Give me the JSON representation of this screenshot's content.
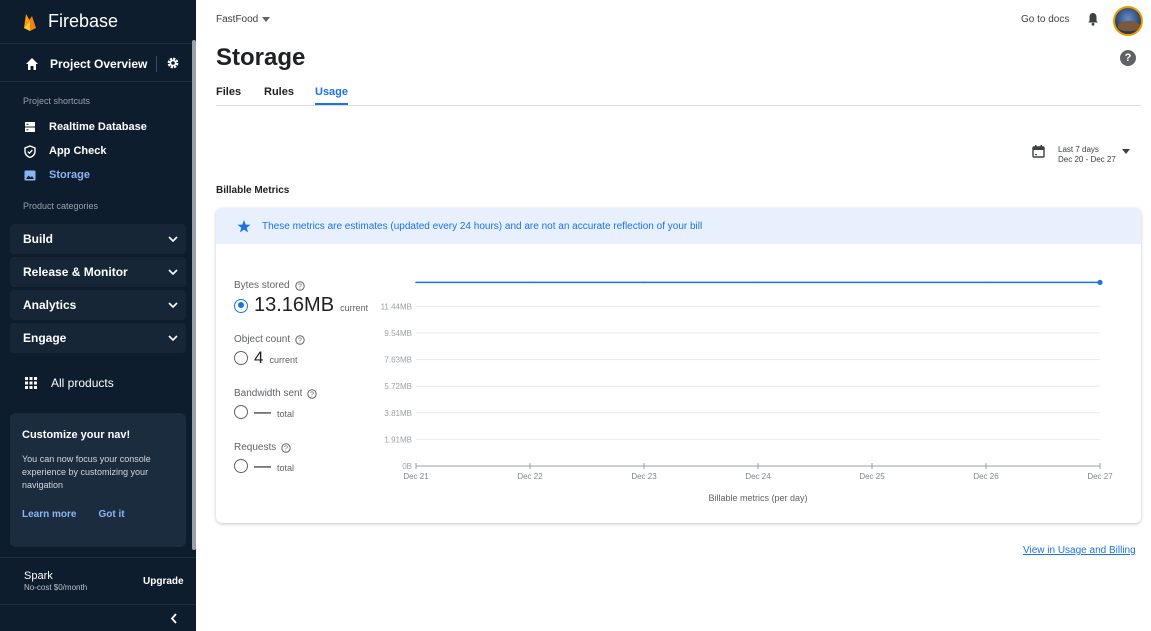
{
  "sidebar": {
    "brand": "Firebase",
    "project_overview": "Project Overview",
    "shortcuts_label": "Project shortcuts",
    "shortcuts": [
      {
        "label": "Realtime Database",
        "icon": "database-icon"
      },
      {
        "label": "App Check",
        "icon": "shield-check-icon"
      },
      {
        "label": "Storage",
        "icon": "storage-icon",
        "active": true
      }
    ],
    "categories_label": "Product categories",
    "categories": [
      "Build",
      "Release & Monitor",
      "Analytics",
      "Engage"
    ],
    "all_products": "All products",
    "customize": {
      "title": "Customize your nav!",
      "text": "You can now focus your console experience by customizing your navigation",
      "learn_more": "Learn more",
      "got_it": "Got it"
    },
    "plan": {
      "name": "Spark",
      "sub": "No-cost $0/month",
      "upgrade": "Upgrade"
    }
  },
  "topbar": {
    "project": "FastFood",
    "docs": "Go to docs"
  },
  "page": {
    "title": "Storage",
    "tabs": [
      {
        "label": "Files",
        "active": false
      },
      {
        "label": "Rules",
        "active": false
      },
      {
        "label": "Usage",
        "active": true
      }
    ],
    "date_range": {
      "title": "Last 7 days",
      "range": "Dec 20 - Dec 27"
    },
    "billable_label": "Billable Metrics",
    "banner": "These metrics are estimates (updated every 24 hours) and are not an accurate reflection of your bill",
    "metrics": [
      {
        "name": "Bytes stored",
        "value": "13.16MB",
        "suffix": "current",
        "selected": true
      },
      {
        "name": "Object count",
        "value": "4",
        "suffix": "current",
        "selected": false
      },
      {
        "name": "Bandwidth sent",
        "value": "—",
        "suffix": "total",
        "selected": false
      },
      {
        "name": "Requests",
        "value": "—",
        "suffix": "total",
        "selected": false
      }
    ],
    "usage_link": "View in Usage and Billing"
  },
  "colors": {
    "accent": "#1a73e8",
    "sidebar_bg": "#0e1d2e",
    "firebase_orange": "#f6a623"
  },
  "chart_data": {
    "type": "line",
    "xlabel": "Billable metrics (per day)",
    "ylabel": "",
    "x": [
      "Dec 21",
      "Dec 22",
      "Dec 23",
      "Dec 24",
      "Dec 25",
      "Dec 26",
      "Dec 27"
    ],
    "y_ticks": [
      "0B",
      "1.91MB",
      "3.81MB",
      "5.72MB",
      "7.63MB",
      "9.54MB",
      "11.44MB"
    ],
    "ylim": [
      0,
      13.16
    ],
    "series": [
      {
        "values": [
          13.16,
          13.16,
          13.16,
          13.16,
          13.16,
          13.16,
          13.16
        ]
      }
    ],
    "grid": true
  }
}
